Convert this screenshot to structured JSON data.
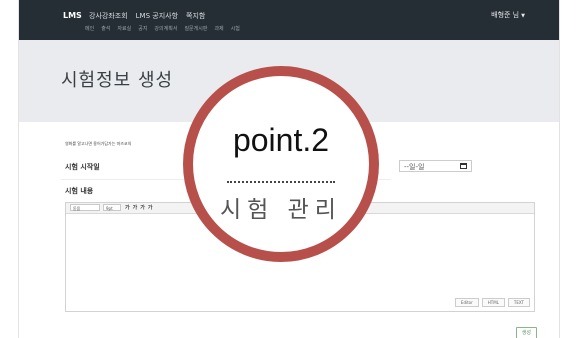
{
  "nav": {
    "brand": "LMS",
    "menu": [
      "강사강좌조회",
      "LMS 공지사항",
      "쪽지함"
    ],
    "submenu": [
      "메인",
      "출석",
      "자료실",
      "공지",
      "강의계획서",
      "질문게시판",
      "과제",
      "시험"
    ],
    "user": "배형준 님"
  },
  "page": {
    "title": "시험정보 생성"
  },
  "form": {
    "notice": "영화를 알고나면 용어가답가는 마즈코의",
    "start_label": "시험 시작일",
    "date_value": "--일-일",
    "content_label": "시험 내용",
    "toolbar": {
      "font": "돋움",
      "size": "9pt",
      "buttons": [
        "가",
        "가",
        "가",
        "가"
      ]
    },
    "editor_tabs": [
      "Editor",
      "HTML",
      "TEXT"
    ],
    "save_label": "생성"
  },
  "overlay": {
    "title": "point.2",
    "subtitle": "시험 관리"
  },
  "colors": {
    "nav_bg": "#262e35",
    "header_bg": "#e9ebee",
    "ring": "#b7504b",
    "save_border": "#8ab58a"
  }
}
